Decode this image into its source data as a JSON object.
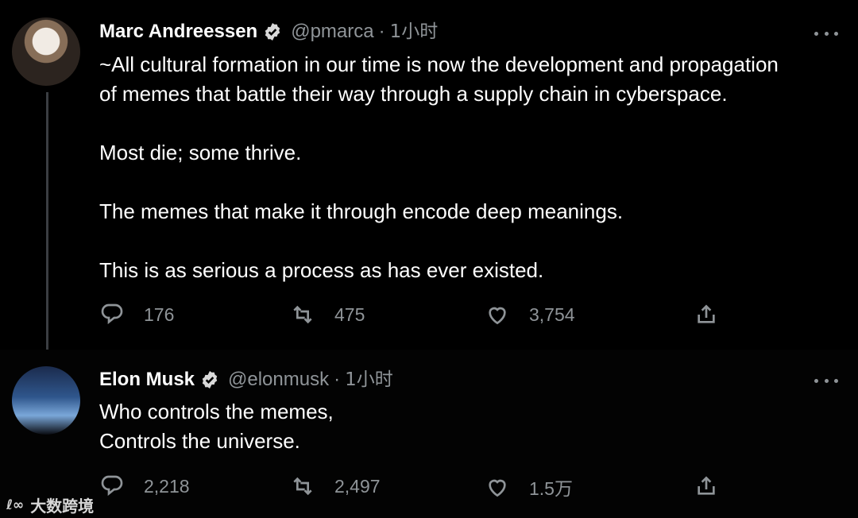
{
  "tweets": [
    {
      "name": "Marc Andreessen",
      "handle": "@pmarca",
      "time": "1小时",
      "text": [
        "~All cultural formation in our time is now the development and propagation",
        "of memes that battle their way through a supply chain in cyberspace.",
        "",
        "Most die; some thrive.",
        "",
        "The memes that make it through encode deep meanings.",
        "",
        "This is as serious a process as has ever existed."
      ],
      "replies": "176",
      "retweets": "475",
      "likes": "3,754"
    },
    {
      "name": "Elon Musk",
      "handle": "@elonmusk",
      "time": "1小时",
      "text": [
        "Who controls the memes,",
        "Controls the universe."
      ],
      "replies": "2,218",
      "retweets": "2,497",
      "likes": "1.5万"
    }
  ],
  "separator": "·",
  "icons": [
    "verified-badge-icon",
    "more-icon",
    "reply-icon",
    "retweet-icon",
    "like-icon",
    "share-icon"
  ],
  "colors": {
    "background": "#000000",
    "text": "#ffffff",
    "muted": "#8f9498"
  },
  "watermark": {
    "logo": "ℓ∞",
    "text": "大数跨境"
  }
}
